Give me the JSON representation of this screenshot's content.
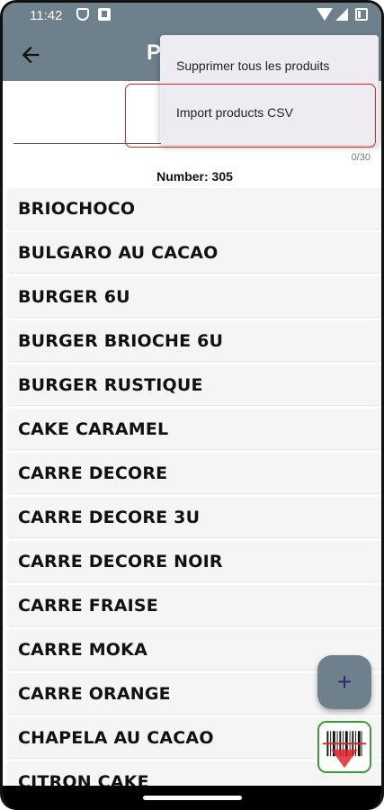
{
  "status": {
    "time": "11:42"
  },
  "appbar": {
    "title_partial": "P"
  },
  "search": {
    "value": "",
    "counter": "0/30"
  },
  "summary": {
    "number_label": "Number: 305"
  },
  "products": [
    "BRIOCHOCO",
    "BULGARO AU CACAO",
    "BURGER 6U",
    "BURGER BRIOCHE 6U",
    "BURGER RUSTIQUE",
    "CAKE CARAMEL",
    "CARRE DECORE",
    "CARRE DECORE 3U",
    "CARRE DECORE NOIR",
    "CARRE FRAISE",
    "CARRE MOKA",
    "CARRE ORANGE",
    "CHAPELA AU CACAO",
    "CITRON CAKE"
  ],
  "menu": {
    "items": [
      "Supprimer tous les produits",
      "Import products CSV"
    ]
  },
  "fab": {
    "add_symbol": "+"
  },
  "colors": {
    "appbar": "#6d808c",
    "highlight": "#e0242c",
    "scan_border": "#3a9a3a"
  }
}
